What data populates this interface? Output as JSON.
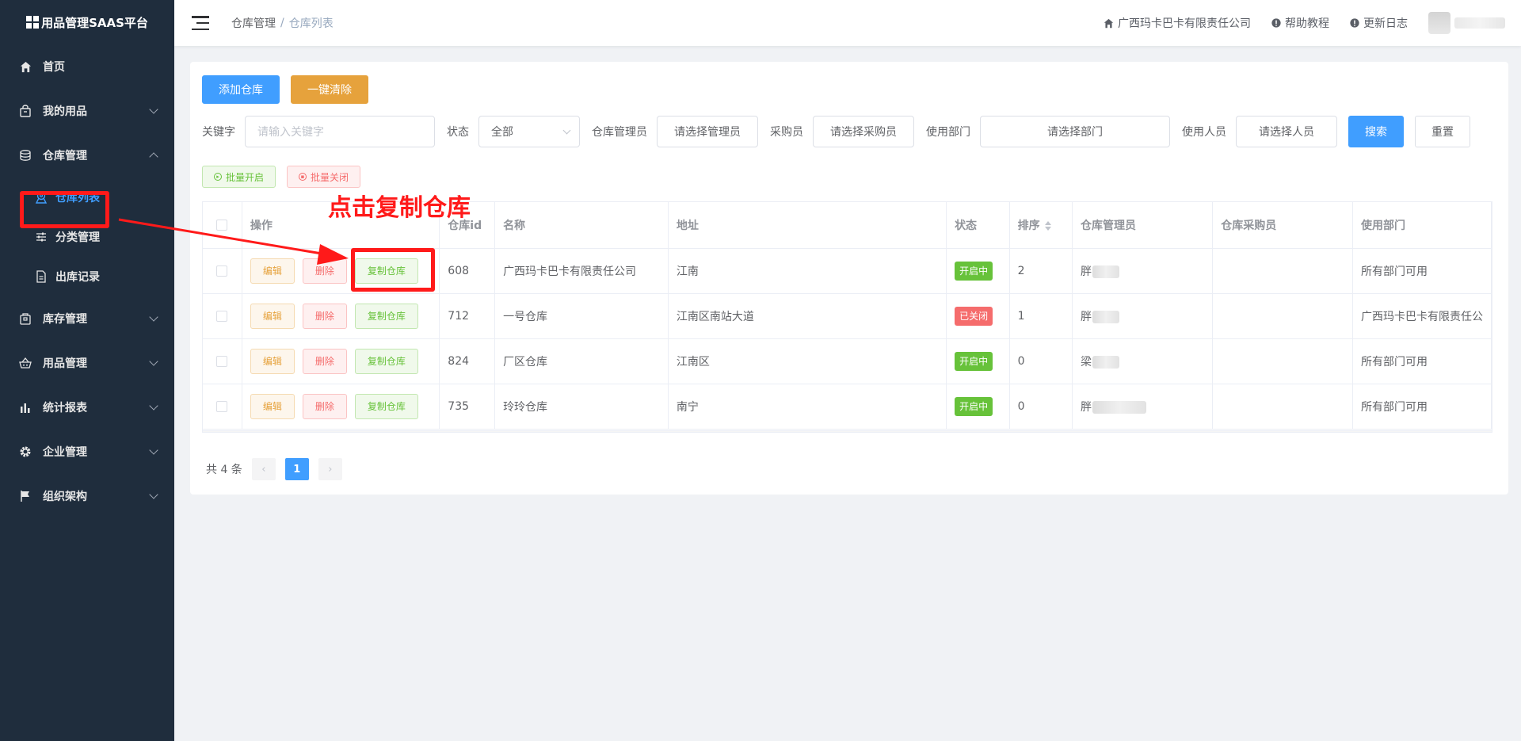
{
  "app": {
    "title": "用品管理SAAS平台"
  },
  "sidebar": {
    "items": [
      {
        "label": "首页",
        "icon": "home-icon"
      },
      {
        "label": "我的用品",
        "icon": "bag-icon"
      },
      {
        "label": "仓库管理",
        "icon": "database-icon",
        "expanded": true,
        "children": [
          {
            "label": "仓库列表",
            "icon": "pin-icon",
            "active": true
          },
          {
            "label": "分类管理",
            "icon": "sliders-icon"
          },
          {
            "label": "出库记录",
            "icon": "document-icon"
          }
        ]
      },
      {
        "label": "库存管理",
        "icon": "box-icon"
      },
      {
        "label": "用品管理",
        "icon": "basket-icon"
      },
      {
        "label": "统计报表",
        "icon": "bar-chart-icon"
      },
      {
        "label": "企业管理",
        "icon": "gear-icon"
      },
      {
        "label": "组织架构",
        "icon": "flag-icon"
      }
    ]
  },
  "header": {
    "breadcrumb": [
      "仓库管理",
      "仓库列表"
    ],
    "breadcrumb_sep": "/",
    "company": "广西玛卡巴卡有限责任公司",
    "help": "帮助教程",
    "changelog": "更新日志"
  },
  "toolbar": {
    "add": "添加仓库",
    "clear": "一键清除"
  },
  "filters": {
    "keyword_label": "关键字",
    "keyword_placeholder": "请输入关键字",
    "status_label": "状态",
    "status_value": "全部",
    "manager_label": "仓库管理员",
    "manager_value": "请选择管理员",
    "buyer_label": "采购员",
    "buyer_value": "请选择采购员",
    "dept_label": "使用部门",
    "dept_value": "请选择部门",
    "user_label": "使用人员",
    "user_value": "请选择人员",
    "search": "搜索",
    "reset": "重置"
  },
  "batch": {
    "open": "批量开启",
    "close": "批量关闭"
  },
  "table": {
    "columns": [
      "操作",
      "仓库id",
      "名称",
      "地址",
      "状态",
      "排序",
      "仓库管理员",
      "仓库采购员",
      "使用部门"
    ],
    "action_labels": {
      "edit": "编辑",
      "delete": "删除",
      "copy": "复制仓库"
    },
    "rows": [
      {
        "id": "608",
        "name": "广西玛卡巴卡有限责任公司",
        "address": "江南",
        "status": "开启中",
        "status_on": true,
        "sort": "2",
        "manager": "胖",
        "buyer": "",
        "dept": "所有部门可用"
      },
      {
        "id": "712",
        "name": "一号仓库",
        "address": "江南区南站大道",
        "status": "已关闭",
        "status_on": false,
        "sort": "1",
        "manager": "胖",
        "buyer": "",
        "dept": "广西玛卡巴卡有限责任公"
      },
      {
        "id": "824",
        "name": "厂区仓库",
        "address": "江南区",
        "status": "开启中",
        "status_on": true,
        "sort": "0",
        "manager": "梁",
        "buyer": "",
        "dept": "所有部门可用"
      },
      {
        "id": "735",
        "name": "玲玲仓库",
        "address": "南宁",
        "status": "开启中",
        "status_on": true,
        "sort": "0",
        "manager": "胖",
        "buyer": "",
        "dept": "所有部门可用"
      }
    ]
  },
  "pagination": {
    "total": "共 4 条",
    "current": "1"
  },
  "annotation": {
    "text": "点击复制仓库",
    "color": "#ff1a1a"
  }
}
